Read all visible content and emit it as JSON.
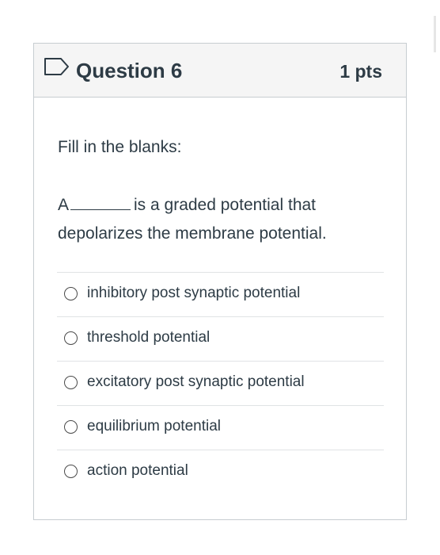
{
  "question": {
    "title": "Question 6",
    "points": "1 pts",
    "instructions": "Fill in the blanks:",
    "text_before_blank": "A",
    "text_after_blank": "is a graded potential that depolarizes the membrane potential.",
    "answers": [
      {
        "label": "inhibitory post synaptic potential",
        "selected": false
      },
      {
        "label": "threshold potential",
        "selected": false
      },
      {
        "label": "excitatory post synaptic potential",
        "selected": false
      },
      {
        "label": "equilibrium potential",
        "selected": false
      },
      {
        "label": "action potential",
        "selected": false
      }
    ]
  },
  "icons": {
    "flag": "flag-outline-icon"
  },
  "colors": {
    "text": "#2d3b45",
    "header_background": "#f5f5f5",
    "border": "#c7cdd1"
  }
}
